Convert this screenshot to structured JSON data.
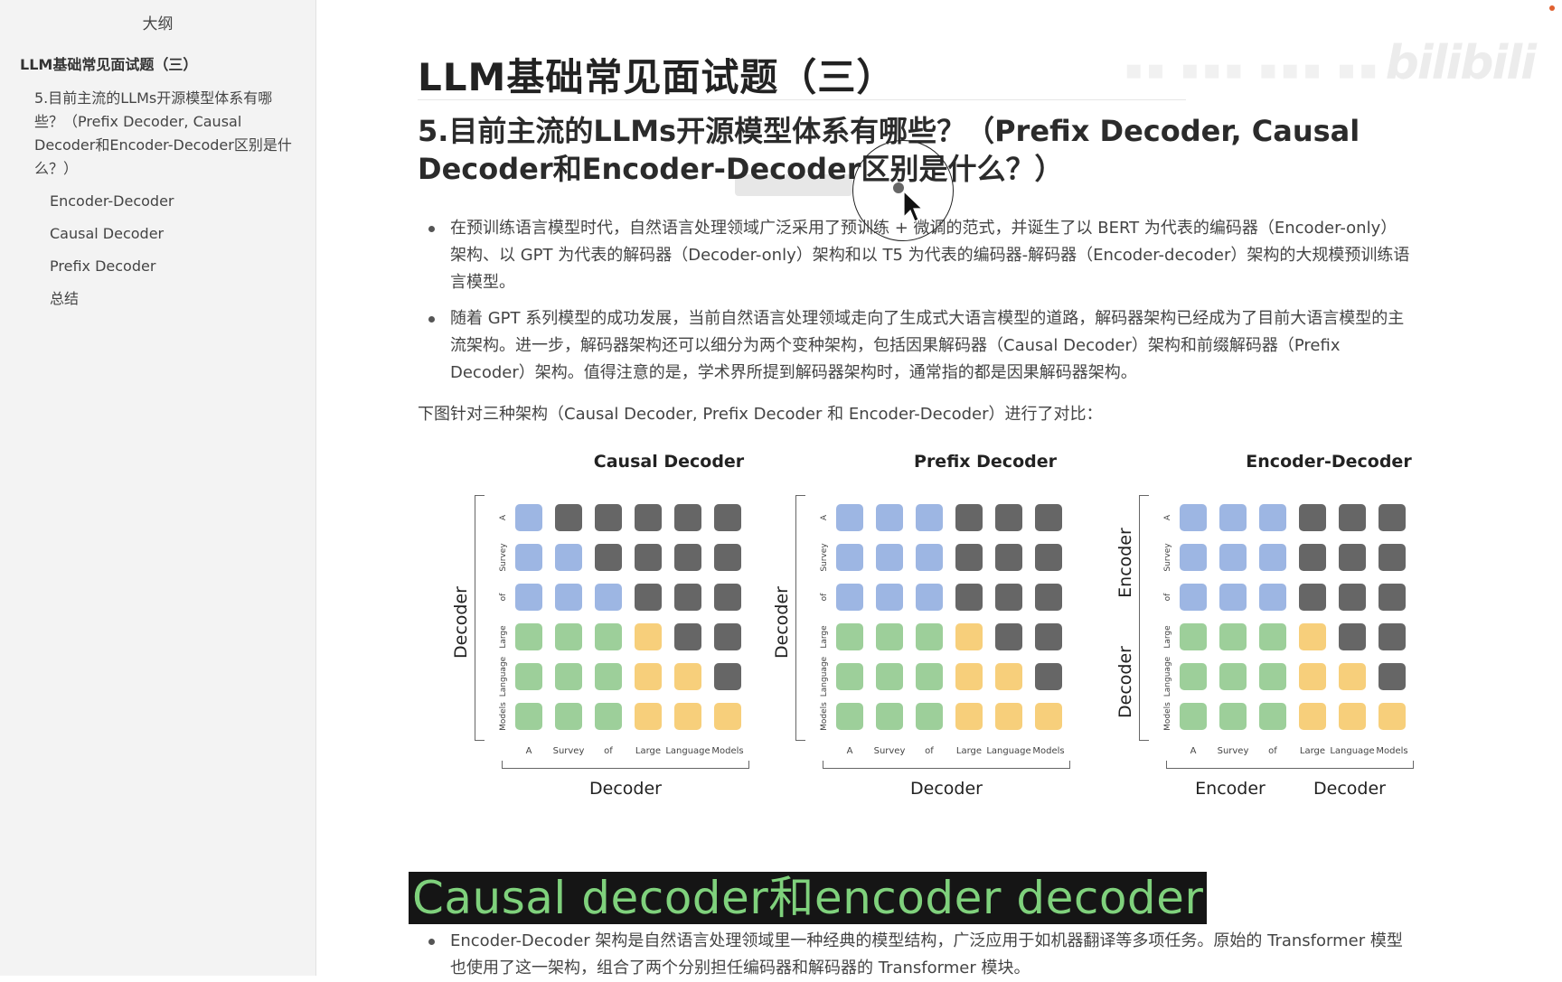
{
  "sidebar": {
    "header": "大纲",
    "items": [
      {
        "label": "LLM基础常见面试题（三）"
      },
      {
        "label": "5.目前主流的LLMs开源模型体系有哪些？（Prefix Decoder, Causal Decoder和Encoder-Decoder区别是什么？）"
      },
      {
        "label": "Encoder-Decoder"
      },
      {
        "label": "Causal Decoder"
      },
      {
        "label": "Prefix Decoder"
      },
      {
        "label": "总结"
      }
    ]
  },
  "watermark": "bilibili",
  "doc": {
    "title": "LLM基础常见面试题（三）",
    "heading": "5.目前主流的LLMs开源模型体系有哪些？（Prefix Decoder, Causal Decoder和Encoder-Decoder区别是什么？）",
    "bullets": [
      "在预训练语言模型时代，自然语言处理领域广泛采用了预训练 + 微调的范式，并诞生了以 BERT 为代表的编码器（Encoder-only）架构、以 GPT 为代表的解码器（Decoder-only）架构和以 T5 为代表的编码器-解码器（Encoder-decoder）架构的大规模预训练语言模型。",
      "随着 GPT 系列模型的成功发展，当前自然语言处理领域走向了生成式大语言模型的道路，解码器架构已经成为了目前大语言模型的主流架构。进一步，解码器架构还可以细分为两个变种架构，包括因果解码器（Causal Decoder）架构和前缀解码器（Prefix Decoder）架构。值得注意的是，学术界所提到解码器架构时，通常指的都是因果解码器架构。"
    ],
    "compare_text": "下图针对三种架构（Causal Decoder, Prefix Decoder 和 Encoder-Decoder）进行了对比：",
    "banner": "Causal decoder和encoder decoder",
    "bottom_bullet": "Encoder-Decoder 架构是自然语言处理领域里一种经典的模型结构，广泛应用于如机器翻译等多项任务。原始的 Transformer 模型也使用了这一架构，组合了两个分别担任编码器和解码器的 Transformer 模块。"
  },
  "figure": {
    "tokens": [
      "A",
      "Survey",
      "of",
      "Large",
      "Language",
      "Models"
    ],
    "colors": {
      "blue": "#9db6e3",
      "green": "#9dcf9a",
      "yellow": "#f7cf7b",
      "gray": "#666666"
    },
    "panels": [
      {
        "title": "Causal Decoder",
        "side_label": "Decoder",
        "bottom_labels": [
          "Decoder"
        ],
        "matrix": [
          "BGGGGG",
          "BBGGGG",
          "BBBGGG",
          "NNNYGG",
          "NNNYYG",
          "NNNYYY"
        ]
      },
      {
        "title": "Prefix Decoder",
        "side_label": "Decoder",
        "bottom_labels": [
          "Decoder"
        ],
        "matrix": [
          "BBBGGG",
          "BBBGGG",
          "BBBGGG",
          "NNNYGG",
          "NNNYYG",
          "NNNYYY"
        ]
      },
      {
        "title": "Encoder-Decoder",
        "side_labels": [
          "Encoder",
          "Decoder"
        ],
        "bottom_labels": [
          "Encoder",
          "Decoder"
        ],
        "matrix": [
          "BBBGGG",
          "BBBGGG",
          "BBBGGG",
          "NNNYGG",
          "NNNYYG",
          "NNNYYY"
        ]
      }
    ]
  }
}
